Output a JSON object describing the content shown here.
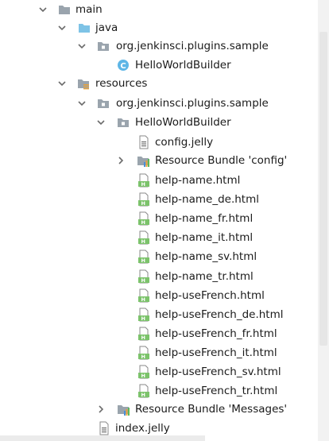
{
  "tree": {
    "main": "main",
    "java": "java",
    "java_package": "org.jenkinsci.plugins.sample",
    "java_class": "HelloWorldBuilder",
    "resources": "resources",
    "res_package": "org.jenkinsci.plugins.sample",
    "res_folder": "HelloWorldBuilder",
    "config_file": "config.jelly",
    "bundle_config": "Resource Bundle 'config'",
    "help_files": [
      "help-name.html",
      "help-name_de.html",
      "help-name_fr.html",
      "help-name_it.html",
      "help-name_sv.html",
      "help-name_tr.html",
      "help-useFrench.html",
      "help-useFrench_de.html",
      "help-useFrench_fr.html",
      "help-useFrench_it.html",
      "help-useFrench_sv.html",
      "help-useFrench_tr.html"
    ],
    "bundle_messages": "Resource Bundle 'Messages'",
    "index_file": "index.jelly"
  },
  "icons": {
    "folder": "folder-icon",
    "source_folder": "source-folder-icon",
    "package": "package-icon",
    "class": "class-icon",
    "resources_folder": "resources-folder-icon",
    "text_file": "text-file-icon",
    "bundle": "resource-bundle-icon",
    "html_file": "html-file-icon"
  },
  "colors": {
    "folder": "#9aa4ad",
    "source_folder": "#7ec3e6",
    "class_badge": "#5eb6e6",
    "html_badge": "#7cc36b",
    "bundle_bars": [
      "#4a8fd8",
      "#e8a23a",
      "#5cb85c"
    ]
  }
}
